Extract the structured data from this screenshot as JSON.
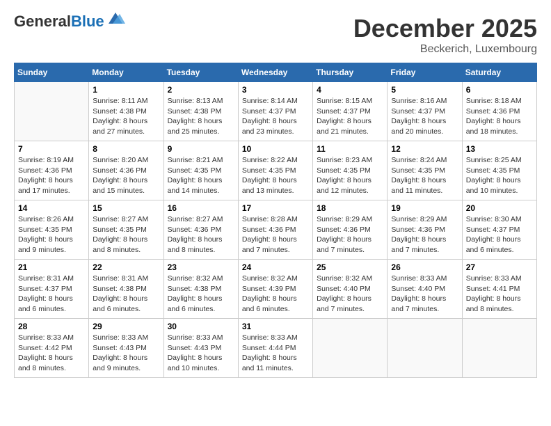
{
  "header": {
    "logo_line1": "General",
    "logo_line2": "Blue",
    "month": "December 2025",
    "location": "Beckerich, Luxembourg"
  },
  "days_of_week": [
    "Sunday",
    "Monday",
    "Tuesday",
    "Wednesday",
    "Thursday",
    "Friday",
    "Saturday"
  ],
  "weeks": [
    [
      {
        "day": "",
        "info": ""
      },
      {
        "day": "1",
        "info": "Sunrise: 8:11 AM\nSunset: 4:38 PM\nDaylight: 8 hours\nand 27 minutes."
      },
      {
        "day": "2",
        "info": "Sunrise: 8:13 AM\nSunset: 4:38 PM\nDaylight: 8 hours\nand 25 minutes."
      },
      {
        "day": "3",
        "info": "Sunrise: 8:14 AM\nSunset: 4:37 PM\nDaylight: 8 hours\nand 23 minutes."
      },
      {
        "day": "4",
        "info": "Sunrise: 8:15 AM\nSunset: 4:37 PM\nDaylight: 8 hours\nand 21 minutes."
      },
      {
        "day": "5",
        "info": "Sunrise: 8:16 AM\nSunset: 4:37 PM\nDaylight: 8 hours\nand 20 minutes."
      },
      {
        "day": "6",
        "info": "Sunrise: 8:18 AM\nSunset: 4:36 PM\nDaylight: 8 hours\nand 18 minutes."
      }
    ],
    [
      {
        "day": "7",
        "info": "Sunrise: 8:19 AM\nSunset: 4:36 PM\nDaylight: 8 hours\nand 17 minutes."
      },
      {
        "day": "8",
        "info": "Sunrise: 8:20 AM\nSunset: 4:36 PM\nDaylight: 8 hours\nand 15 minutes."
      },
      {
        "day": "9",
        "info": "Sunrise: 8:21 AM\nSunset: 4:35 PM\nDaylight: 8 hours\nand 14 minutes."
      },
      {
        "day": "10",
        "info": "Sunrise: 8:22 AM\nSunset: 4:35 PM\nDaylight: 8 hours\nand 13 minutes."
      },
      {
        "day": "11",
        "info": "Sunrise: 8:23 AM\nSunset: 4:35 PM\nDaylight: 8 hours\nand 12 minutes."
      },
      {
        "day": "12",
        "info": "Sunrise: 8:24 AM\nSunset: 4:35 PM\nDaylight: 8 hours\nand 11 minutes."
      },
      {
        "day": "13",
        "info": "Sunrise: 8:25 AM\nSunset: 4:35 PM\nDaylight: 8 hours\nand 10 minutes."
      }
    ],
    [
      {
        "day": "14",
        "info": "Sunrise: 8:26 AM\nSunset: 4:35 PM\nDaylight: 8 hours\nand 9 minutes."
      },
      {
        "day": "15",
        "info": "Sunrise: 8:27 AM\nSunset: 4:35 PM\nDaylight: 8 hours\nand 8 minutes."
      },
      {
        "day": "16",
        "info": "Sunrise: 8:27 AM\nSunset: 4:36 PM\nDaylight: 8 hours\nand 8 minutes."
      },
      {
        "day": "17",
        "info": "Sunrise: 8:28 AM\nSunset: 4:36 PM\nDaylight: 8 hours\nand 7 minutes."
      },
      {
        "day": "18",
        "info": "Sunrise: 8:29 AM\nSunset: 4:36 PM\nDaylight: 8 hours\nand 7 minutes."
      },
      {
        "day": "19",
        "info": "Sunrise: 8:29 AM\nSunset: 4:36 PM\nDaylight: 8 hours\nand 7 minutes."
      },
      {
        "day": "20",
        "info": "Sunrise: 8:30 AM\nSunset: 4:37 PM\nDaylight: 8 hours\nand 6 minutes."
      }
    ],
    [
      {
        "day": "21",
        "info": "Sunrise: 8:31 AM\nSunset: 4:37 PM\nDaylight: 8 hours\nand 6 minutes."
      },
      {
        "day": "22",
        "info": "Sunrise: 8:31 AM\nSunset: 4:38 PM\nDaylight: 8 hours\nand 6 minutes."
      },
      {
        "day": "23",
        "info": "Sunrise: 8:32 AM\nSunset: 4:38 PM\nDaylight: 8 hours\nand 6 minutes."
      },
      {
        "day": "24",
        "info": "Sunrise: 8:32 AM\nSunset: 4:39 PM\nDaylight: 8 hours\nand 6 minutes."
      },
      {
        "day": "25",
        "info": "Sunrise: 8:32 AM\nSunset: 4:40 PM\nDaylight: 8 hours\nand 7 minutes."
      },
      {
        "day": "26",
        "info": "Sunrise: 8:33 AM\nSunset: 4:40 PM\nDaylight: 8 hours\nand 7 minutes."
      },
      {
        "day": "27",
        "info": "Sunrise: 8:33 AM\nSunset: 4:41 PM\nDaylight: 8 hours\nand 8 minutes."
      }
    ],
    [
      {
        "day": "28",
        "info": "Sunrise: 8:33 AM\nSunset: 4:42 PM\nDaylight: 8 hours\nand 8 minutes."
      },
      {
        "day": "29",
        "info": "Sunrise: 8:33 AM\nSunset: 4:43 PM\nDaylight: 8 hours\nand 9 minutes."
      },
      {
        "day": "30",
        "info": "Sunrise: 8:33 AM\nSunset: 4:43 PM\nDaylight: 8 hours\nand 10 minutes."
      },
      {
        "day": "31",
        "info": "Sunrise: 8:33 AM\nSunset: 4:44 PM\nDaylight: 8 hours\nand 11 minutes."
      },
      {
        "day": "",
        "info": ""
      },
      {
        "day": "",
        "info": ""
      },
      {
        "day": "",
        "info": ""
      }
    ]
  ]
}
